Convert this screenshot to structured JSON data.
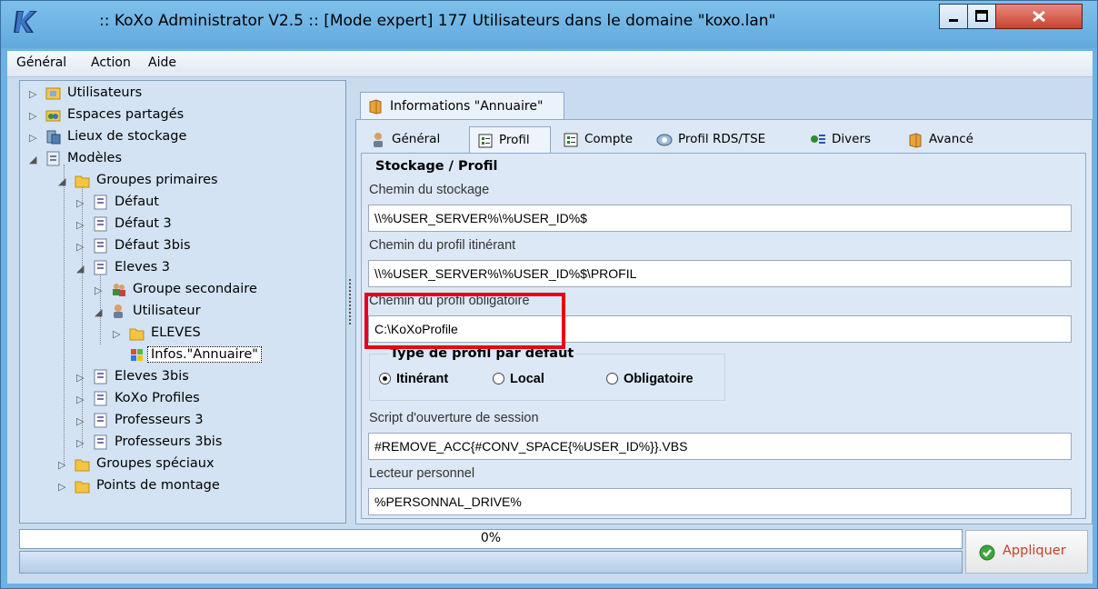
{
  "window": {
    "title": ":: KoXo Administrator V2.5 :: [Mode expert] 177 Utilisateurs dans le domaine \"koxo.lan\""
  },
  "menu": [
    {
      "label": "Général"
    },
    {
      "label": "Action"
    },
    {
      "label": "Aide"
    }
  ],
  "tree": [
    {
      "label": "Utilisateurs",
      "icon": "users-folder-icon",
      "expander": "▷"
    },
    {
      "label": "Espaces partagés",
      "icon": "shared-spaces-icon",
      "expander": "▷"
    },
    {
      "label": "Lieux de stockage",
      "icon": "storage-icon",
      "expander": "▷"
    },
    {
      "label": "Modèles",
      "icon": "templates-icon",
      "expander": "◢"
    },
    {
      "label": "Groupes primaires",
      "icon": "folder-icon",
      "expander": "◢"
    },
    {
      "label": "Défaut",
      "icon": "document-icon",
      "expander": "▷"
    },
    {
      "label": "Défaut 3",
      "icon": "document-icon",
      "expander": "▷"
    },
    {
      "label": "Défaut 3bis",
      "icon": "document-icon",
      "expander": "▷"
    },
    {
      "label": "Eleves 3",
      "icon": "document-icon",
      "expander": "◢"
    },
    {
      "label": "Groupe secondaire",
      "icon": "group-icon",
      "expander": "▷"
    },
    {
      "label": "Utilisateur",
      "icon": "user-icon",
      "expander": "◢"
    },
    {
      "label": "ELEVES",
      "icon": "folder-icon",
      "expander": "▷"
    },
    {
      "label": "Infos.\"Annuaire\"",
      "icon": "windows-logo-icon",
      "expander": ""
    },
    {
      "label": "Eleves 3bis",
      "icon": "document-icon",
      "expander": "▷"
    },
    {
      "label": "KoXo Profiles",
      "icon": "document-icon",
      "expander": "▷"
    },
    {
      "label": "Professeurs 3",
      "icon": "document-icon",
      "expander": "▷"
    },
    {
      "label": "Professeurs 3bis",
      "icon": "document-icon",
      "expander": "▷"
    },
    {
      "label": "Groupes spéciaux",
      "icon": "folder-icon",
      "expander": "▷"
    },
    {
      "label": "Points de montage",
      "icon": "folder-icon",
      "expander": "▷"
    }
  ],
  "outer_tab": {
    "label": "Informations \"Annuaire\""
  },
  "tabs": [
    {
      "label": "Général",
      "icon": "user-icon"
    },
    {
      "label": "Profil",
      "icon": "profile-icon"
    },
    {
      "label": "Compte",
      "icon": "account-icon"
    },
    {
      "label": "Profil RDS/TSE",
      "icon": "rds-icon"
    },
    {
      "label": "Divers",
      "icon": "misc-icon"
    },
    {
      "label": "Avancé",
      "icon": "advanced-icon"
    }
  ],
  "group_title": "Stockage / Profil",
  "fields": [
    {
      "label": "Chemin du stockage",
      "value": "\\\\%USER_SERVER%\\%USER_ID%$"
    },
    {
      "label": "Chemin du profil itinérant",
      "value": "\\\\%USER_SERVER%\\%USER_ID%$\\PROFIL"
    },
    {
      "label": "Chemin du profil obligatoire",
      "value": "C:\\KoXoProfile"
    },
    {
      "label": "Script d'ouverture de session",
      "value": "#REMOVE_ACC{#CONV_SPACE{%USER_ID%}}.VBS"
    },
    {
      "label": "Lecteur personnel",
      "value": "%PERSONNAL_DRIVE%"
    }
  ],
  "profile_type": {
    "title": "Type de profil par défaut",
    "options": [
      "Itinérant",
      "Local",
      "Obligatoire"
    ],
    "selected": "Itinérant"
  },
  "progress": {
    "text": "0%",
    "value": 0
  },
  "apply_button": {
    "label": "Appliquer"
  },
  "colors": {
    "accent": "#e8001a",
    "titlebar": "#6cb2e4"
  }
}
